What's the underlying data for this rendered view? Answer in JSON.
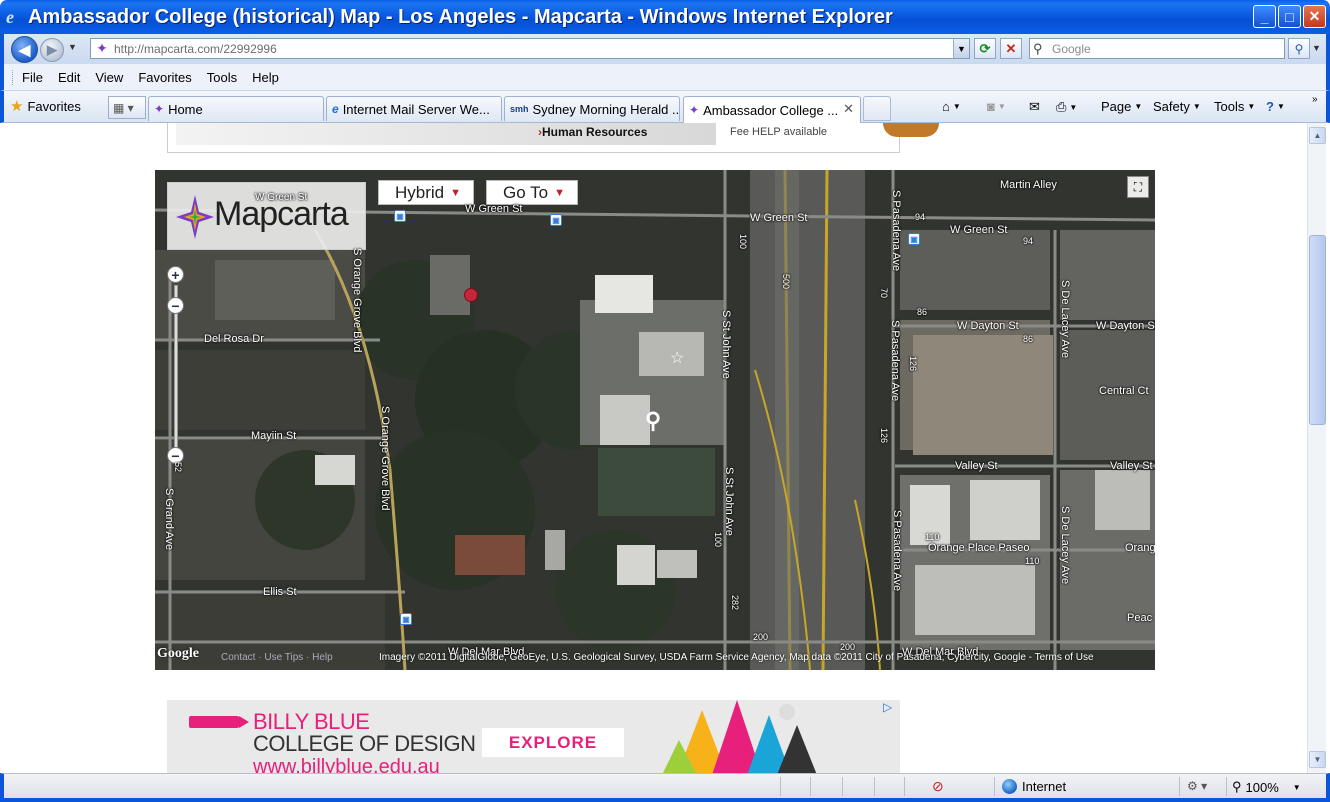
{
  "window": {
    "title": "Ambassador College (historical) Map - Los Angeles - Mapcarta - Windows Internet Explorer",
    "minimize": "_",
    "maximize": "□",
    "close": "✕"
  },
  "address": {
    "url": "http://mapcarta.com/22992996",
    "search_placeholder": "Google"
  },
  "menu": [
    "File",
    "Edit",
    "View",
    "Favorites",
    "Tools",
    "Help"
  ],
  "tabs": {
    "favorites_label": "Favorites",
    "items": [
      {
        "label": "Home",
        "icon": "mapcarta-star-icon"
      },
      {
        "label": "Internet Mail Server We...",
        "icon": "ie-icon"
      },
      {
        "label": "Sydney Morning Herald ...",
        "icon": "smh-icon"
      },
      {
        "label": "Ambassador College ...",
        "icon": "mapcarta-star-icon",
        "active": true
      }
    ],
    "commands": [
      "Page",
      "Safety",
      "Tools"
    ]
  },
  "top_ad": {
    "text": "Human Resources",
    "sub": "Fee HELP available"
  },
  "map": {
    "logo_text": "Mapcarta",
    "map_type": "Hybrid",
    "goto": "Go To",
    "streets": {
      "w_green_st": "W Green St",
      "w_green_st_2": "W Green St",
      "w_green_st_3": "W Green St",
      "w_green_st_4": "W Green St",
      "martin_alley": "Martin Alley",
      "del_rosa": "Del Rosa Dr",
      "mayin": "Mayiin St",
      "ellis": "Ellis St",
      "w_del_mar": "W Del Mar Blvd",
      "s_orange_grove": "S Orange Grove Blvd",
      "s_orange_grove_2": "S Orange Grove Blvd",
      "s_st_john": "S St John Ave",
      "s_st_john_2": "S St John Ave",
      "s_grand": "S Grand Ave",
      "w_dayton": "W Dayton St",
      "w_dayton_2": "W Dayton St",
      "s_pasadena": "S Pasadena Ave",
      "s_pasadena_2": "S Pasadena Ave",
      "s_pasadena_3": "S Pasadena Ave",
      "s_de_lacey": "S De Lacey Ave",
      "s_de_lacey_2": "S De Lacey Ave",
      "central_ct": "Central Ct",
      "valley_st": "Valley St",
      "valley_st_2": "Valley St",
      "orange_place": "Orange Place Paseo",
      "orange_cut": "Orang",
      "peach_cut": "Peac"
    },
    "numbers": [
      "94",
      "94",
      "86",
      "86",
      "100",
      "100",
      "500",
      "70",
      "126",
      "126",
      "110",
      "110",
      "200",
      "200",
      "282",
      "52"
    ],
    "attribution": "Imagery ©2011 DigitalGlobe, GeoEye, U.S. Geological Survey, USDA Farm Service Agency, Map data ©2011 City of Pasadena, Cybercity, Google - Terms of Use",
    "google": "Google",
    "contact": "Contact · Use Tips · Help"
  },
  "bottom_ad": {
    "line1": "BILLY BLUE",
    "line2": "COLLEGE OF DESIGN",
    "url": "www.billyblue.edu.au",
    "cta": "EXPLORE",
    "choices": "▷"
  },
  "status": {
    "zone": "Internet",
    "zoom": "100%"
  },
  "colors": {
    "accent": "#0a55d8",
    "ad_pink": "#e7217b"
  }
}
